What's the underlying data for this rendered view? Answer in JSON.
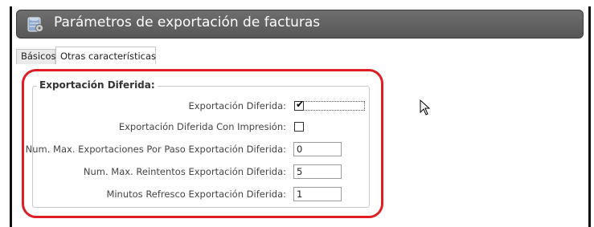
{
  "window": {
    "title": "Parámetros de exportación de facturas",
    "icon": "settings-database-icon"
  },
  "tabs": [
    {
      "label": "Básicos",
      "active": false
    },
    {
      "label": "Otras características",
      "active": true
    }
  ],
  "group": {
    "title": "Exportación Diferida:",
    "fields": {
      "exportacion_diferida": {
        "label": "Exportación Diferida:",
        "checked": true
      },
      "con_impresion": {
        "label": "Exportación Diferida Con Impresión:",
        "checked": false
      },
      "max_exportaciones": {
        "label": "Num. Max. Exportaciones Por Paso Exportación Diferida:",
        "value": "0"
      },
      "max_reintentos": {
        "label": "Num. Max. Reintentos Exportación Diferida:",
        "value": "5"
      },
      "minutos_refresco": {
        "label": "Minutos Refresco Exportación Diferida:",
        "value": "1"
      }
    }
  },
  "colors": {
    "titlebar": "#5f5f5f",
    "highlight": "#e01c24"
  }
}
